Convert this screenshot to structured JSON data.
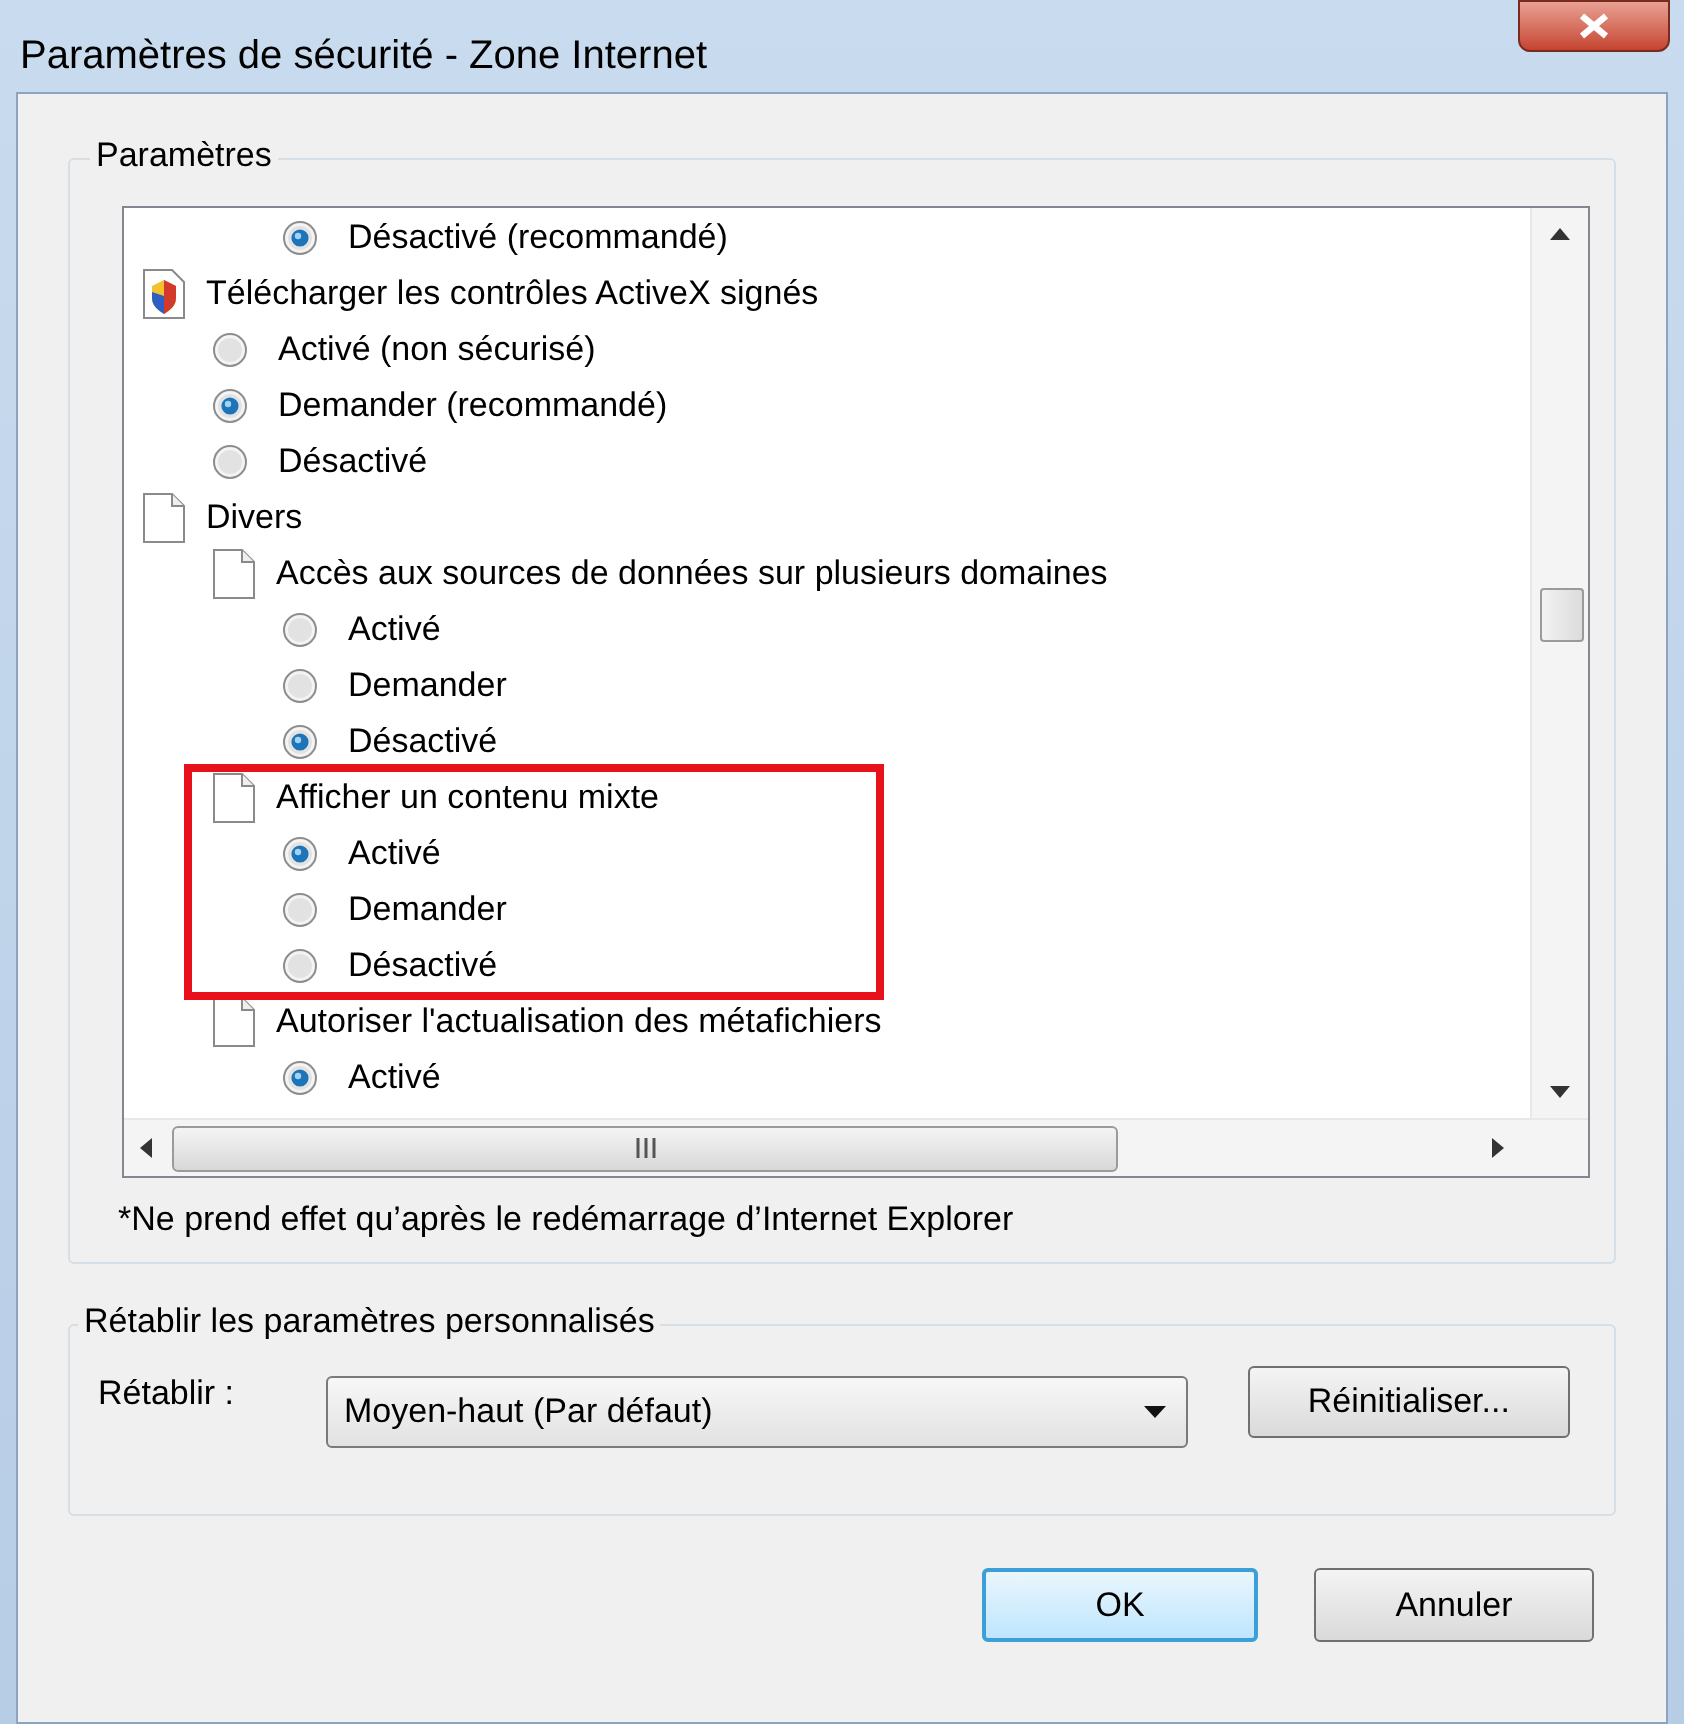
{
  "window": {
    "title": "Paramètres de sécurité - Zone Internet"
  },
  "settings_group": {
    "title": "Paramètres",
    "tree": [
      {
        "children": [
          {
            "kind": "option",
            "label": "Désactivé (recommandé)",
            "selected": true
          }
        ]
      },
      {
        "kind": "activex",
        "label": "Télécharger les contrôles ActiveX signés",
        "children": [
          {
            "kind": "option",
            "label": "Activé (non sécurisé)",
            "selected": false
          },
          {
            "kind": "option",
            "label": "Demander (recommandé)",
            "selected": true
          },
          {
            "kind": "option",
            "label": "Désactivé",
            "selected": false
          }
        ]
      },
      {
        "kind": "page",
        "label": "Divers",
        "children": [
          {
            "kind": "page",
            "label": "Accès aux sources de données sur plusieurs domaines",
            "children": [
              {
                "kind": "option",
                "label": "Activé",
                "selected": false
              },
              {
                "kind": "option",
                "label": "Demander",
                "selected": false
              },
              {
                "kind": "option",
                "label": "Désactivé",
                "selected": true
              }
            ]
          },
          {
            "kind": "page",
            "label": "Afficher un contenu mixte",
            "highlighted": true,
            "children": [
              {
                "kind": "option",
                "label": "Activé",
                "selected": true
              },
              {
                "kind": "option",
                "label": "Demander",
                "selected": false
              },
              {
                "kind": "option",
                "label": "Désactivé",
                "selected": false
              }
            ]
          },
          {
            "kind": "page",
            "label": "Autoriser l'actualisation des métafichiers",
            "children": [
              {
                "kind": "option",
                "label": "Activé",
                "selected": true
              }
            ]
          }
        ]
      }
    ],
    "note": "*Ne prend effet qu’après le redémarrage d’Internet Explorer"
  },
  "reset_group": {
    "title": "Rétablir les paramètres personnalisés",
    "label": "Rétablir :",
    "dropdown_value": "Moyen-haut (Par défaut)",
    "reset_button": "Réinitialiser..."
  },
  "buttons": [
    {
      "label": "OK",
      "default": true
    },
    {
      "label": "Annuler",
      "default": false
    }
  ]
}
